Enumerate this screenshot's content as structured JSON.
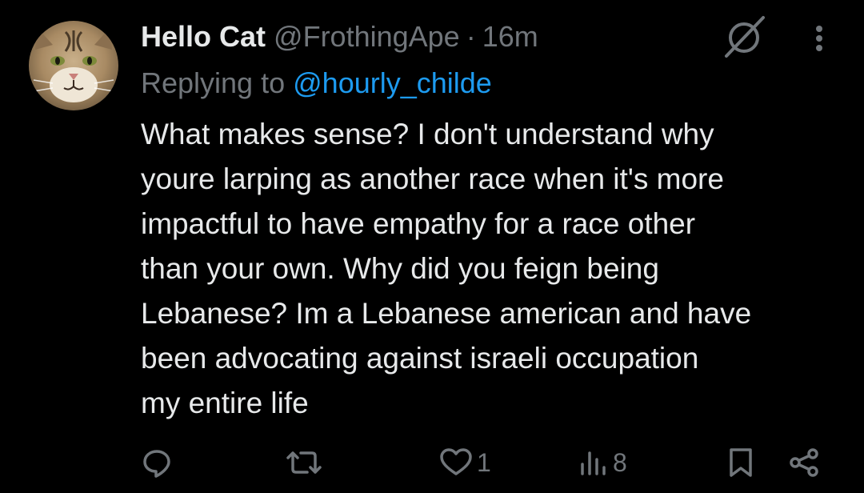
{
  "tweet": {
    "author": {
      "display_name": "Hello Cat",
      "handle": "@FrothingApe",
      "avatar": "cat-face-avatar"
    },
    "separator": "·",
    "timestamp": "16m",
    "reply": {
      "prefix": "Replying to",
      "handle": "@hourly_childe"
    },
    "body_lines": [
      "What makes sense? I don't understand why",
      "youre larping as another race when it's more",
      "impactful to have empathy for a race other",
      "than your own. Why did you feign being",
      "Lebanese? Im a Lebanese american and have",
      "been advocating against israeli occupation",
      "my entire life"
    ],
    "actions": {
      "reply_icon": "reply-icon",
      "retweet_icon": "retweet-icon",
      "like_icon": "heart-icon",
      "like_count": "1",
      "views_icon": "analytics-icon",
      "views_count": "8",
      "bookmark_icon": "bookmark-icon",
      "share_icon": "share-icon"
    },
    "header_icons": {
      "verified": "verified-badge-icon",
      "more": "more-options-icon"
    }
  },
  "colors": {
    "background": "#000000",
    "primary_text": "#e7e9ea",
    "secondary_text": "#71767b",
    "link": "#1d9bf0"
  }
}
